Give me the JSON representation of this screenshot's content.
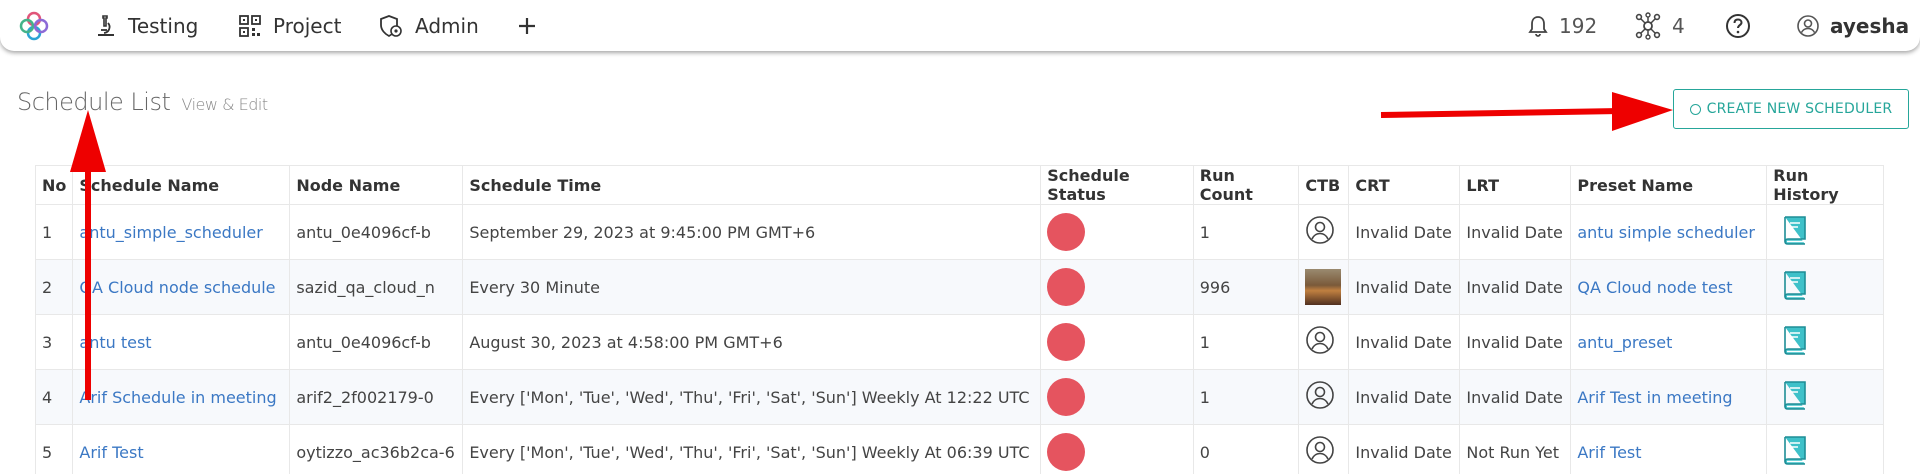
{
  "nav": {
    "items": [
      {
        "label": "Testing",
        "icon": "microscope-icon"
      },
      {
        "label": "Project",
        "icon": "qr-grid-icon"
      },
      {
        "label": "Admin",
        "icon": "admin-shield-icon"
      }
    ],
    "add_icon": "plus-icon",
    "notifications_count": "192",
    "nodes_count": "4",
    "help_icon": "help-icon",
    "username": "ayesha"
  },
  "page": {
    "title": "Schedule List",
    "subtitle": "View & Edit",
    "create_button": "CREATE NEW SCHEDULER"
  },
  "table": {
    "headers": [
      "No",
      "Schedule Name",
      "Node Name",
      "Schedule Time",
      "Schedule Status",
      "Run Count",
      "CTB",
      "CRT",
      "LRT",
      "Preset Name",
      "Run History"
    ],
    "rows": [
      {
        "no": "1",
        "name": "antu_simple_scheduler",
        "node": "antu_0e4096cf-b",
        "time": "September 29, 2023 at 9:45:00 PM GMT+6",
        "status_color": "#e5545f",
        "run_count": "1",
        "ctb": "user-icon",
        "crt": "Invalid Date",
        "lrt": "Invalid Date",
        "preset": "antu simple scheduler"
      },
      {
        "no": "2",
        "name": "QA Cloud node schedule",
        "node": "sazid_qa_cloud_n",
        "time": "Every 30 Minute",
        "status_color": "#e5545f",
        "run_count": "996",
        "ctb": "avatar-photo",
        "crt": "Invalid Date",
        "lrt": "Invalid Date",
        "preset": "QA Cloud node test"
      },
      {
        "no": "3",
        "name": "antu test",
        "node": "antu_0e4096cf-b",
        "time": "August 30, 2023 at 4:58:00 PM GMT+6",
        "status_color": "#e5545f",
        "run_count": "1",
        "ctb": "user-icon",
        "crt": "Invalid Date",
        "lrt": "Invalid Date",
        "preset": "antu_preset"
      },
      {
        "no": "4",
        "name": "Arif Schedule in meeting",
        "node": "arif2_2f002179-0",
        "time": "Every ['Mon', 'Tue', 'Wed', 'Thu', 'Fri', 'Sat', 'Sun'] Weekly At 12:22 UTC",
        "status_color": "#e5545f",
        "run_count": "1",
        "ctb": "user-icon",
        "crt": "Invalid Date",
        "lrt": "Invalid Date",
        "preset": "Arif Test in meeting"
      },
      {
        "no": "5",
        "name": "Arif Test",
        "node": "oytizzo_ac36b2ca-6",
        "time": "Every ['Mon', 'Tue', 'Wed', 'Thu', 'Fri', 'Sat', 'Sun'] Weekly At 06:39 UTC",
        "status_color": "#e5545f",
        "run_count": "0",
        "ctb": "user-icon",
        "crt": "Invalid Date",
        "lrt": "Not Run Yet",
        "preset": "Arif Test"
      }
    ]
  },
  "colors": {
    "accent": "#26a69a",
    "link": "#3b78c4",
    "status_red": "#e5545f",
    "annotation_arrow": "#ee0000"
  }
}
